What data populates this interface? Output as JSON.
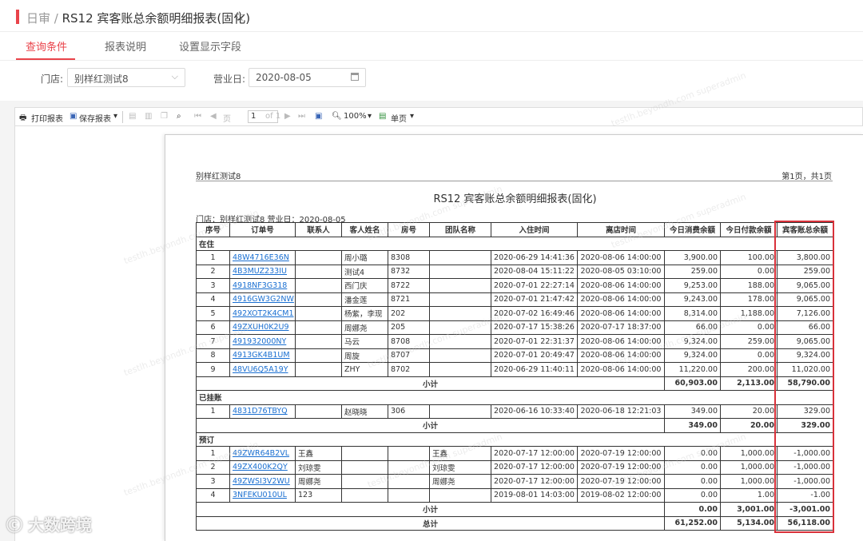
{
  "header": {
    "section": "日审",
    "separator": " / ",
    "title": "RS12 宾客账总余额明细报表(固化)"
  },
  "tabs": [
    {
      "label": "查询条件",
      "active": true
    },
    {
      "label": "报表说明",
      "active": false
    },
    {
      "label": "设置显示字段",
      "active": false
    }
  ],
  "filters": {
    "store_label": "门店:",
    "store_value": "别样红测试8",
    "date_label": "营业日:",
    "date_value": "2020-08-05"
  },
  "toolbar": {
    "print": "打印报表",
    "save": "保存报表",
    "page_prefix": "页",
    "page_value": "1",
    "page_of": "of 1",
    "zoom": "100%",
    "view_mode": "单页"
  },
  "report": {
    "store_name": "别样红测试8",
    "page_info": "第1页，共1页",
    "title": "RS12 宾客账总余额明细报表(固化)",
    "params": "门店：别样红测试8    营业日：2020-08-05",
    "headers": [
      "序号",
      "订单号",
      "联系人",
      "客人姓名",
      "房号",
      "团队名称",
      "入住时间",
      "离店时间",
      "今日消费余額",
      "今日付款余額",
      "宾客账总余額"
    ],
    "groups": [
      {
        "name": "在住",
        "rows": [
          [
            "1",
            "48W4716E36N",
            "",
            "周小璐",
            "8308",
            "",
            "2020-06-29 14:41:36",
            "2020-08-06 14:00:00",
            "3,900.00",
            "100.00",
            "3,800.00"
          ],
          [
            "2",
            "4B3MUZ233IU",
            "",
            "测试4",
            "8732",
            "",
            "2020-08-04 15:11:22",
            "2020-08-05 03:10:00",
            "259.00",
            "0.00",
            "259.00"
          ],
          [
            "3",
            "4918NF3G318",
            "",
            "西门庆",
            "8722",
            "",
            "2020-07-01 22:27:14",
            "2020-08-06 14:00:00",
            "9,253.00",
            "188.00",
            "9,065.00"
          ],
          [
            "4",
            "4916GW3G2NW",
            "",
            "潘金莲",
            "8721",
            "",
            "2020-07-01 21:47:42",
            "2020-08-06 14:00:00",
            "9,243.00",
            "178.00",
            "9,065.00"
          ],
          [
            "5",
            "492XOT2K4CM1",
            "",
            "杨紫，李现",
            "202",
            "",
            "2020-07-02 16:49:46",
            "2020-08-06 14:00:00",
            "8,314.00",
            "1,188.00",
            "7,126.00"
          ],
          [
            "6",
            "49ZXUH0K2U9",
            "",
            "周娜尧",
            "205",
            "",
            "2020-07-17 15:38:26",
            "2020-07-17 18:37:00",
            "66.00",
            "0.00",
            "66.00"
          ],
          [
            "7",
            "491932000NY",
            "",
            "马云",
            "8708",
            "",
            "2020-07-01 22:31:37",
            "2020-08-06 14:00:00",
            "9,324.00",
            "259.00",
            "9,065.00"
          ],
          [
            "8",
            "4913GK4B1UM",
            "",
            "周旋",
            "8707",
            "",
            "2020-07-01 20:49:47",
            "2020-08-06 14:00:00",
            "9,324.00",
            "0.00",
            "9,324.00"
          ],
          [
            "9",
            "48VU6Q5A19Y",
            "",
            "ZHY",
            "8702",
            "",
            "2020-06-29 11:40:11",
            "2020-08-06 14:00:00",
            "11,220.00",
            "200.00",
            "11,020.00"
          ]
        ],
        "subtotal": {
          "label": "小计",
          "consume": "60,903.00",
          "pay": "2,113.00",
          "total": "58,790.00"
        }
      },
      {
        "name": "已挂账",
        "rows": [
          [
            "1",
            "4831D76TBYQ",
            "",
            "赵晓晓",
            "306",
            "",
            "2020-06-16 10:33:40",
            "2020-06-18 12:21:03",
            "349.00",
            "20.00",
            "329.00"
          ]
        ],
        "subtotal": {
          "label": "小计",
          "consume": "349.00",
          "pay": "20.00",
          "total": "329.00"
        }
      },
      {
        "name": "预订",
        "rows": [
          [
            "1",
            "49ZWR64B2VL",
            "王鑫",
            "",
            "",
            "王鑫",
            "2020-07-17 12:00:00",
            "2020-07-19 12:00:00",
            "0.00",
            "1,000.00",
            "-1,000.00"
          ],
          [
            "2",
            "49ZX400K2QY",
            "刘琼雯",
            "",
            "",
            "刘琼雯",
            "2020-07-17 12:00:00",
            "2020-07-19 12:00:00",
            "0.00",
            "1,000.00",
            "-1,000.00"
          ],
          [
            "3",
            "49ZWSI3V2WU",
            "周娜尧",
            "",
            "",
            "周娜尧",
            "2020-07-17 12:00:00",
            "2020-07-19 12:00:00",
            "0.00",
            "1,000.00",
            "-1,000.00"
          ],
          [
            "4",
            "3NFEKU010UL",
            "123",
            "",
            "",
            "",
            "2019-08-01 14:03:00",
            "2019-08-02 12:00:00",
            "0.00",
            "1.00",
            "-1.00"
          ]
        ],
        "subtotal": {
          "label": "小计",
          "consume": "0.00",
          "pay": "3,001.00",
          "total": "-3,001.00"
        }
      }
    ],
    "grand_total": {
      "label": "总计",
      "consume": "61,252.00",
      "pay": "5,134.00",
      "total": "56,118.00"
    }
  },
  "watermark_text": "testlh.beyondh.com superadmin",
  "logo_text": "大数跨境",
  "colors": {
    "accent": "#e9434a",
    "link": "#1a6fd1",
    "highlight": "#d9313a"
  }
}
